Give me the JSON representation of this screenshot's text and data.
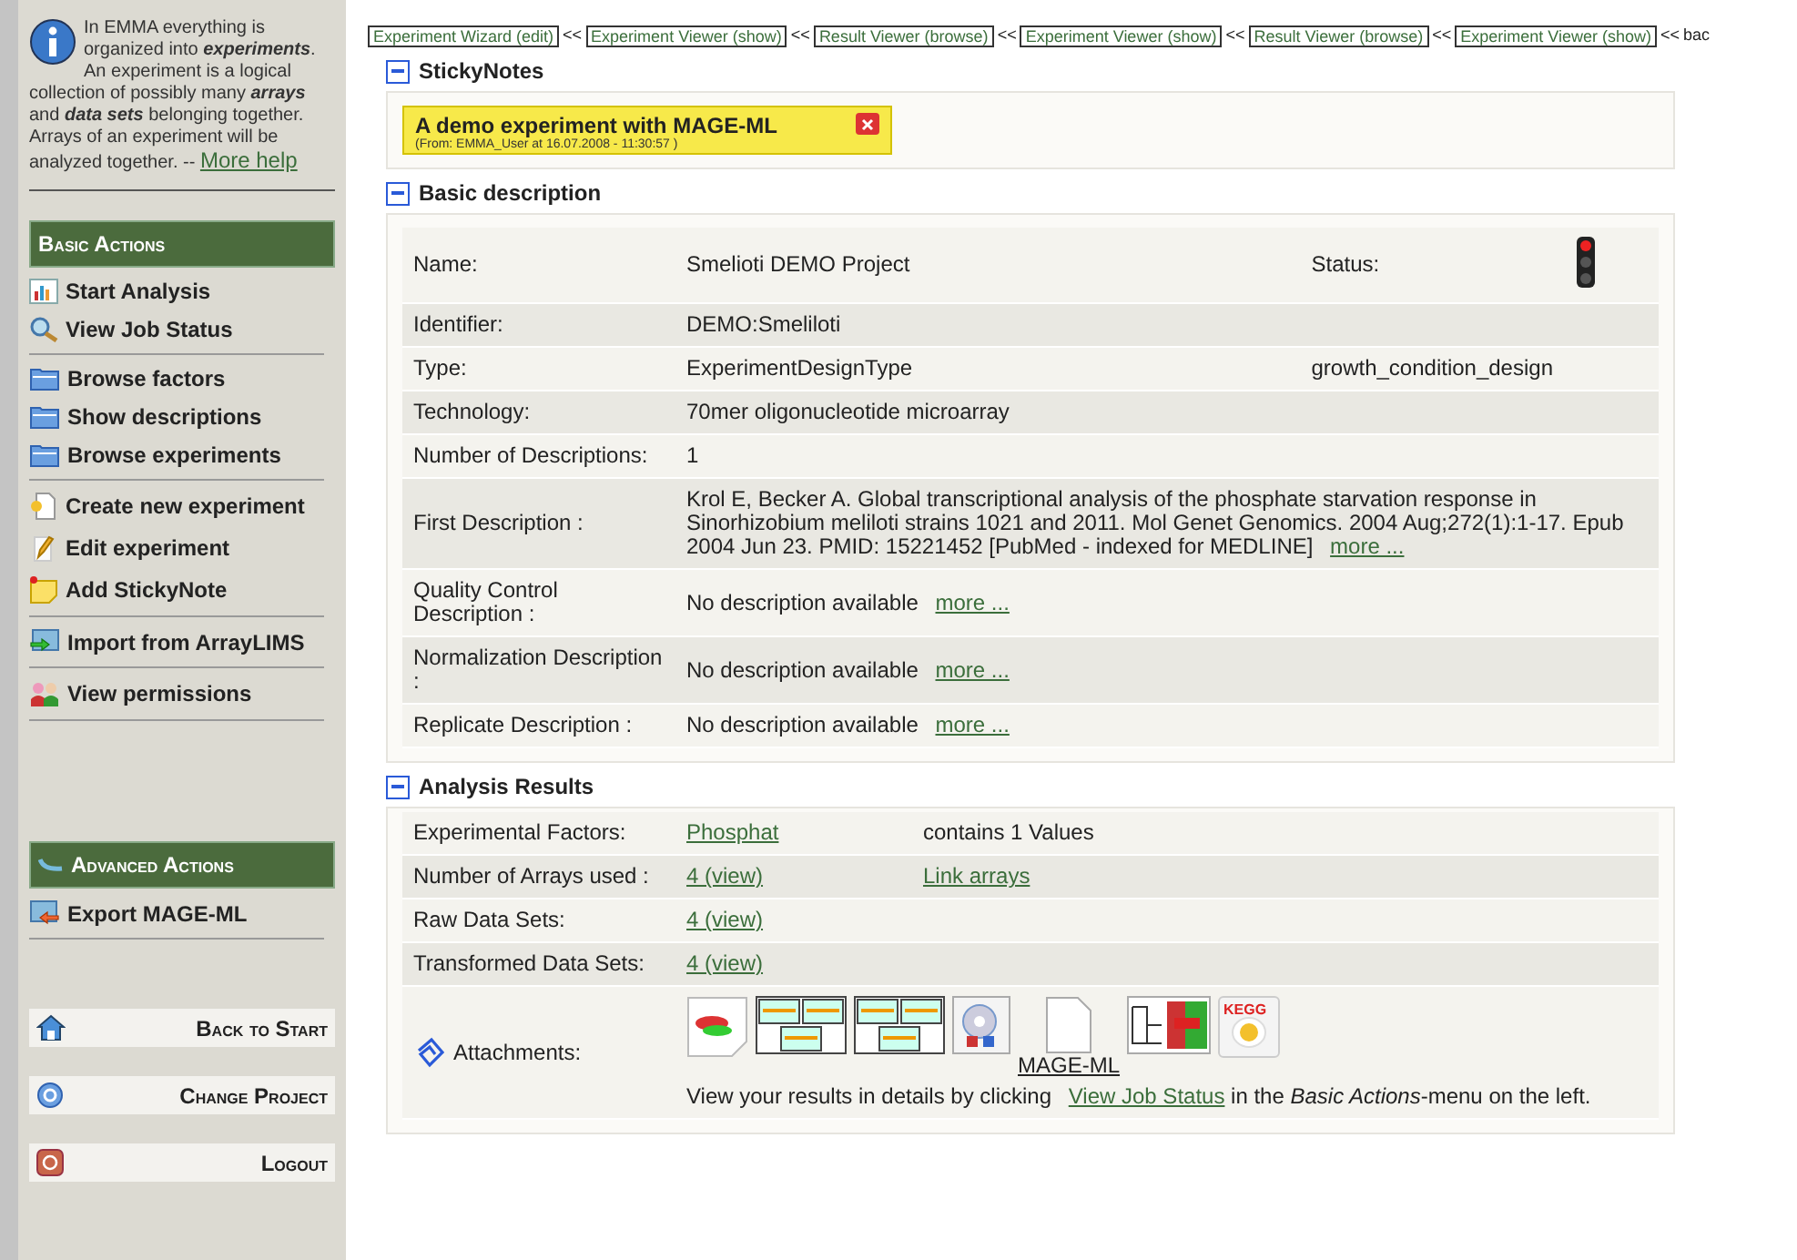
{
  "sidebar": {
    "info_text": "In EMMA everything is organized into **experiments**. An experiment is a logical collection of possibly many **arrays** and **data sets** belonging together. Arrays of an experiment will be analyzed together. --",
    "more_help": "More help",
    "basic_actions": {
      "title": "Basic Actions",
      "groups": [
        [
          {
            "label": "Start Analysis",
            "kind": "chart"
          },
          {
            "label": "View Job Status",
            "kind": "search"
          }
        ],
        [
          {
            "label": "Browse factors",
            "kind": "folder"
          },
          {
            "label": "Show descriptions",
            "kind": "folder"
          },
          {
            "label": "Browse experiments",
            "kind": "folder"
          }
        ],
        [
          {
            "label": "Create new experiment",
            "kind": "new"
          },
          {
            "label": "Edit experiment",
            "kind": "edit"
          },
          {
            "label": "Add StickyNote",
            "kind": "note"
          }
        ],
        [
          {
            "label": "Import from ArrayLIMS",
            "kind": "import"
          }
        ],
        [
          {
            "label": "View permissions",
            "kind": "people"
          }
        ]
      ]
    },
    "advanced_actions": {
      "title": "Advanced Actions",
      "groups": [
        [
          {
            "label": "Export MAGE-ML",
            "kind": "export"
          }
        ]
      ]
    },
    "nav_buttons": [
      {
        "label": "Back to Start",
        "kind": "home"
      },
      {
        "label": "Change Project",
        "kind": "circle"
      },
      {
        "label": "Logout",
        "kind": "power"
      }
    ]
  },
  "breadcrumbs": [
    {
      "label": "Experiment Wizard (edit)",
      "sep": "<<"
    },
    {
      "label": "Experiment Viewer (show)",
      "sep": "<<"
    },
    {
      "label": "Result Viewer (browse)",
      "sep": "<<"
    },
    {
      "label": "Experiment Viewer (show)",
      "sep": "<<"
    },
    {
      "label": "Result Viewer (browse)",
      "sep": "<<"
    },
    {
      "label": "Experiment Viewer (show)",
      "sep": "<<"
    }
  ],
  "breadcrumb_tail": "bac",
  "sticky_notes": {
    "title": "StickyNotes",
    "expanded": true,
    "notes": [
      {
        "title": "A demo experiment with MAGE-ML",
        "meta": "(From: EMMA_User at 16.07.2008 - 11:30:57 )"
      }
    ]
  },
  "basic_description": {
    "title": "Basic description",
    "expanded": true,
    "rows": [
      {
        "label": "Name:",
        "value": "Smelioti DEMO Project",
        "extra_label": "Status:",
        "kind": "status_red"
      },
      {
        "label": "Identifier:",
        "value": "DEMO:Smeliloti"
      },
      {
        "label": "Type:",
        "value": "ExperimentDesignType",
        "extra_label": "growth_condition_design"
      },
      {
        "label": "Technology:",
        "value": "70mer oligonucleotide microarray"
      },
      {
        "label": "Number of Descriptions:",
        "value": "1"
      },
      {
        "label": "First Description :",
        "value": "Krol E, Becker A. Global transcriptional analysis of the phosphate starvation response in Sinorhizobium meliloti strains 1021 and 2011. Mol Genet Genomics. 2004 Aug;272(1):1-17. Epub 2004 Jun 23. PMID: 15221452 [PubMed - indexed for MEDLINE]",
        "link": "more ..."
      },
      {
        "label": "Quality Control Description :",
        "value": "No description available",
        "link": "more ..."
      },
      {
        "label": "Normalization Description :",
        "value": "No description available",
        "link": "more ..."
      },
      {
        "label": "Replicate Description :",
        "value": "No description available",
        "link": "more ..."
      }
    ]
  },
  "analysis_results": {
    "title": "Analysis Results",
    "expanded": true,
    "rows": [
      {
        "label": "Experimental Factors:",
        "cells": [
          {
            "text": "Phosphat",
            "kind": "link"
          },
          {
            "text": "contains 1 Values",
            "kind": "text"
          }
        ]
      },
      {
        "label": "Number of Arrays used :",
        "cells": [
          {
            "text": "4 (view)",
            "kind": "link"
          },
          {
            "text": "Link arrays",
            "kind": "link"
          }
        ]
      },
      {
        "label": "Raw Data Sets:",
        "cells": [
          {
            "text": "4 (view)",
            "kind": "link"
          }
        ]
      },
      {
        "label": "Transformed Data Sets:",
        "cells": [
          {
            "text": "4 (view)",
            "kind": "link"
          }
        ]
      }
    ],
    "attachments": {
      "label": "Attachments:",
      "items": [
        {
          "kind": "scatter"
        },
        {
          "kind": "panels"
        },
        {
          "kind": "panels"
        },
        {
          "kind": "disc"
        },
        {
          "kind": "document",
          "caption": "MAGE-ML"
        },
        {
          "kind": "heatmap"
        },
        {
          "kind": "kegg",
          "caption": "KEGG"
        }
      ],
      "note_before": "View your results in details by clicking",
      "note_link": "View Job Status",
      "note_after": "in the *Basic Actions*-menu on the left."
    }
  }
}
